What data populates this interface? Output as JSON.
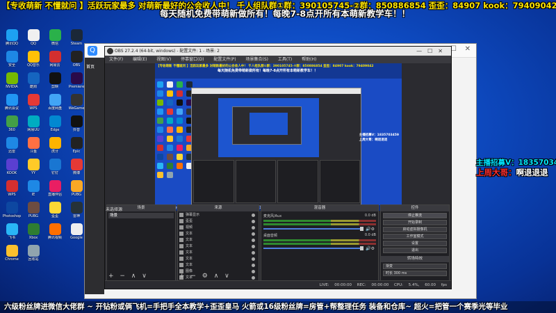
{
  "overlay": {
    "line1": "【专收萌新 不懂就问 】活跃玩家最多 对萌新最好的公会收人中！ 千人组队群①群：390105745-②群：850886854  歪歪：84907  kook：79409042",
    "line2a": "每天随机免费带萌新做所有！每晚7-8点开所有本萌新教学车！！",
    "line2b": "",
    "bottom_banner": "六级粉丝牌进微信大佬群 ~  开钻粉或俩飞机=手把手全本教学+歪歪皇马     火箭或16级粉丝牌=房管+帮整理任务 装备和仓库~  超火=把管一个赛季光等毕业",
    "side_recruit": "主播招募V：1835703459",
    "side_week": "上周大哥：",
    "side_week_name": "啊退退退",
    "colors": {
      "yellow": "#ffe500",
      "cyan": "#00e5ff",
      "red": "#ff3030"
    }
  },
  "desktop": {
    "icons": [
      {
        "label": "腾讯QQ",
        "color": "#1da1f2"
      },
      {
        "label": "QQ",
        "color": "#f0f0f0"
      },
      {
        "label": "微信",
        "color": "#2ab14a"
      },
      {
        "label": "Steam",
        "color": "#1b2838"
      },
      {
        "label": "安全",
        "color": "#1e88e5"
      },
      {
        "label": "QQ音乐",
        "color": "#ffc107"
      },
      {
        "label": "网易云",
        "color": "#d32f2f"
      },
      {
        "label": "OBS",
        "color": "#222"
      },
      {
        "label": "NVIDIA",
        "color": "#76b900"
      },
      {
        "label": "酷狗",
        "color": "#1565c0"
      },
      {
        "label": "剪映",
        "color": "#111"
      },
      {
        "label": "Premiere",
        "color": "#2a0a4a"
      },
      {
        "label": "腾讯会议",
        "color": "#2196f3"
      },
      {
        "label": "WPS",
        "color": "#e53935"
      },
      {
        "label": "百度网盘",
        "color": "#42a5f5"
      },
      {
        "label": "WeGame",
        "color": "#333"
      },
      {
        "label": "360",
        "color": "#43a047"
      },
      {
        "label": "网易UU",
        "color": "#00acc1"
      },
      {
        "label": "Edge",
        "color": "#0288d1"
      },
      {
        "label": "抖音",
        "color": "#111"
      },
      {
        "label": "迅雷",
        "color": "#1e88e5"
      },
      {
        "label": "斗鱼",
        "color": "#ff7043"
      },
      {
        "label": "虎牙",
        "color": "#ffb300"
      },
      {
        "label": "Epic",
        "color": "#222"
      },
      {
        "label": "KOOK",
        "color": "#5a3fd1"
      },
      {
        "label": "YY",
        "color": "#ffca28"
      },
      {
        "label": "钉钉",
        "color": "#1976d2"
      },
      {
        "label": "微博",
        "color": "#e53935"
      },
      {
        "label": "WPS",
        "color": "#d32f2f"
      },
      {
        "label": "IE",
        "color": "#1e88e5"
      },
      {
        "label": "直播伴侣",
        "color": "#e91e63"
      },
      {
        "label": "PUBG",
        "color": "#f9a825"
      },
      {
        "label": "Photoshop",
        "color": "#0d47a1"
      },
      {
        "label": "PUBG",
        "color": "#6d4c41"
      },
      {
        "label": "歪歪",
        "color": "#fdd835"
      },
      {
        "label": "雷神",
        "color": "#263238"
      },
      {
        "label": "飞书",
        "color": "#29b6f6"
      },
      {
        "label": "Xbox",
        "color": "#2e7d32"
      },
      {
        "label": "腾讯视频",
        "color": "#ff6f00"
      },
      {
        "label": "Google",
        "color": "#eeeeee"
      },
      {
        "label": "Chrome",
        "color": "#fbc02d"
      },
      {
        "label": "回收站",
        "color": "#90a4ae"
      }
    ]
  },
  "browser": {
    "title": "",
    "nav_home": "首页"
  },
  "obs": {
    "title": "OBS 27.2.4 (64-bit, windows) - 配置文件: 1 - 场景: 2",
    "menu": "文件(F) 编辑(E) 视图(V) 停靠窗口(D) 配置文件(P) 场景集合(S) 工具(T) 帮助(H)",
    "chat_label": "未选择源",
    "docks": {
      "scenes_header": "场景",
      "sources_header": "来源",
      "mixer_header": "混音器",
      "controls_header": "控件",
      "scene_rows": [
        "场景"
      ],
      "sources": [
        "弹幕显示",
        "歪歪",
        "视频",
        "文本",
        "文本",
        "文本",
        "文本",
        "文本",
        "文本",
        "图像",
        "文本"
      ],
      "mixer_tracks": [
        {
          "name": "麦克风/Aux",
          "db": "0.0 dB"
        },
        {
          "name": "桌面音频",
          "db": "0.0 dB"
        }
      ],
      "controls": [
        "停止推流",
        "开始录制",
        "启动虚拟摄像机",
        "工作室模式",
        "设置",
        "退出"
      ],
      "transition_header": "转场特效",
      "transition_value": "渐变",
      "duration_label": "时长",
      "duration_value": "300 ms"
    },
    "status": "LIVE: 00:00:00  REC: 00:00:00  CPU: 5.4%, 60.00 fps"
  },
  "preview": {
    "t1": "【专收萌新 不懂就问 】活跃玩家最多 对萌新最好的公会收人中！ 千人组队群①群：390105745-②群：850886854 歪歪：84907 kook：79409042",
    "t2": "每天随机免费带萌新做所有！每晚7-8点开所有本萌新教学车！！",
    "side1": "主播招募V：1835703459",
    "side2": "上周大哥：啊退退退",
    "bottom": "六级粉丝牌进微信大佬群 ~ 开钻粉或俩飞机=手把手全本教学+歪歪皇马  火箭或16级粉丝牌=房管+帮整理任务 装备和仓库~ 超火=把管一个赛季光等毕业"
  }
}
